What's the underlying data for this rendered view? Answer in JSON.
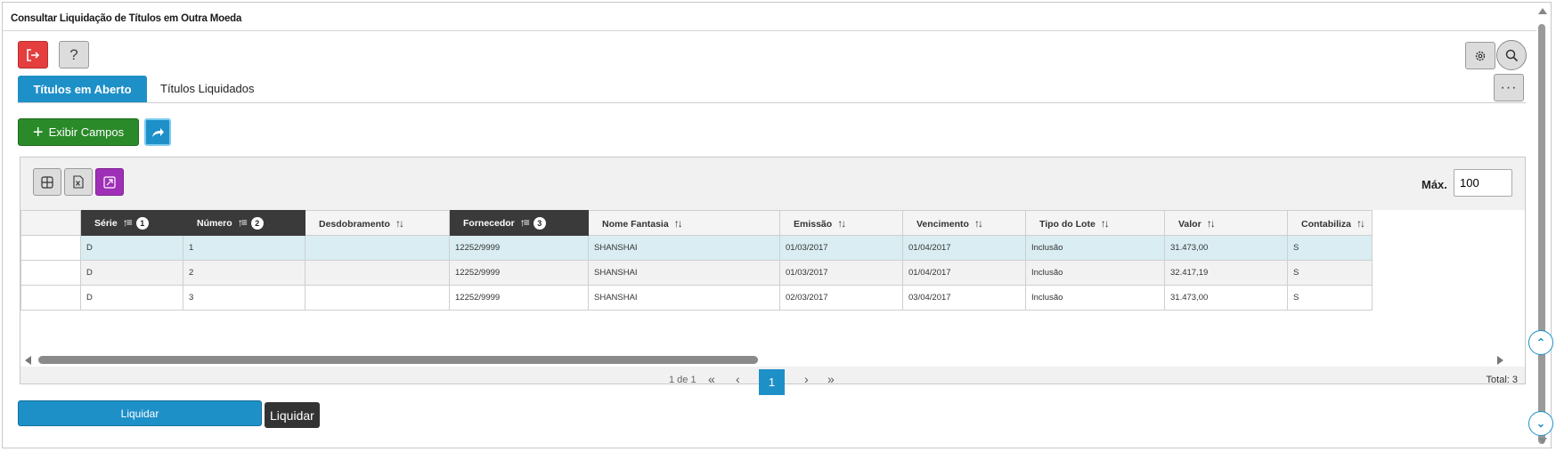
{
  "window": {
    "title": "Consultar Liquidação de Títulos em Outra Moeda"
  },
  "toolbar": {
    "exit_icon": "exit-icon",
    "help_label": "?",
    "gear_icon": "gear-icon",
    "search_icon": "search-icon"
  },
  "tabs": [
    {
      "label": "Títulos em Aberto",
      "active": true
    },
    {
      "label": "Títulos Liquidados",
      "active": false
    }
  ],
  "more_label": "···",
  "actions": {
    "exibir_label": "Exibir Campos",
    "share_icon": "share-icon"
  },
  "grid": {
    "max_label": "Máx.",
    "max_value": "100",
    "columns": [
      {
        "label": "",
        "sort": ""
      },
      {
        "label": "Série",
        "sort": "asc",
        "order": "1"
      },
      {
        "label": "Número",
        "sort": "asc",
        "order": "2"
      },
      {
        "label": "Desdobramento",
        "sort": "none"
      },
      {
        "label": "Fornecedor",
        "sort": "asc",
        "order": "3"
      },
      {
        "label": "Nome Fantasia",
        "sort": "none"
      },
      {
        "label": "Emissão",
        "sort": "none"
      },
      {
        "label": "Vencimento",
        "sort": "none"
      },
      {
        "label": "Tipo do Lote",
        "sort": "none"
      },
      {
        "label": "Valor",
        "sort": "none"
      },
      {
        "label": "Contabiliza",
        "sort": "none"
      }
    ],
    "rows": [
      [
        "",
        "D",
        "1",
        "",
        "12252/9999",
        "SHANSHAI",
        "01/03/2017",
        "01/04/2017",
        "Inclusão",
        "31.473,00",
        "S"
      ],
      [
        "",
        "D",
        "2",
        "",
        "12252/9999",
        "SHANSHAI",
        "01/03/2017",
        "01/04/2017",
        "Inclusão",
        "32.417,19",
        "S"
      ],
      [
        "",
        "D",
        "3",
        "",
        "12252/9999",
        "SHANSHAI",
        "02/03/2017",
        "03/04/2017",
        "Inclusão",
        "31.473,00",
        "S"
      ]
    ],
    "pager": {
      "info": "1 de 1",
      "first": "«",
      "prev": "‹",
      "page": "1",
      "next": "›",
      "last": "»",
      "total": "Total: 3"
    }
  },
  "footer": {
    "liquidar_label": "Liquidar",
    "tooltip": "Liquidar"
  },
  "colors": {
    "primary": "#1e90c8",
    "success": "#2a8a2a",
    "danger": "#e53e3e",
    "accent_purple": "#a02fb8"
  }
}
